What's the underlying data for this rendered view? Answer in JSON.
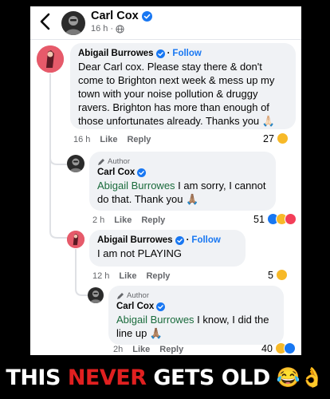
{
  "header": {
    "name": "Carl Cox",
    "time": "16 h",
    "icons": [
      "back-arrow-icon",
      "verified-badge-icon",
      "globe-icon"
    ]
  },
  "comments": [
    {
      "author": "Abigail Burrowes",
      "follow": "Follow",
      "text": "Dear Carl cox. Please stay there & don't come to Brighton  next week & mess up my town with your noise pollution & druggy ravers. Brighton has more than enough of those unfortunates already. Thanks  you 🙏🏻",
      "time": "16 h",
      "like": "Like",
      "reply": "Reply",
      "reactions": "27",
      "reaction_icons": [
        "haha-emoji"
      ]
    },
    {
      "author_badge": "Author",
      "author": "Carl Cox",
      "mention": "Abigail Burrowes",
      "text": " I am sorry, I cannot do that. Thank you 🙏🏽",
      "time": "2 h",
      "like": "Like",
      "reply": "Reply",
      "reactions": "51",
      "reaction_icons": [
        "like-emoji",
        "haha-emoji",
        "love-emoji"
      ]
    },
    {
      "author": "Abigail Burrowes",
      "follow": "Follow",
      "text": "I am not PLAYING",
      "time": "12 h",
      "like": "Like",
      "reply": "Reply",
      "reactions": "5",
      "reaction_icons": [
        "haha-emoji"
      ]
    },
    {
      "author_badge": "Author",
      "author": "Carl Cox",
      "mention": "Abigail Burrowes",
      "text": " I know, I did the line up 🙏🏽",
      "time": "2h",
      "like": "Like",
      "reply": "Reply",
      "reactions": "40",
      "reaction_icons": [
        "haha-emoji",
        "like-emoji"
      ]
    }
  ],
  "footer": {
    "part1": "THIS ",
    "part2": "NEVER",
    "part3": " GETS OLD",
    "emojis": "😂👌"
  },
  "colors": {
    "facebook_blue": "#1877f2",
    "bubble": "#f0f2f5",
    "mention_green": "#1a6b3c",
    "headline_red": "#e02020"
  }
}
